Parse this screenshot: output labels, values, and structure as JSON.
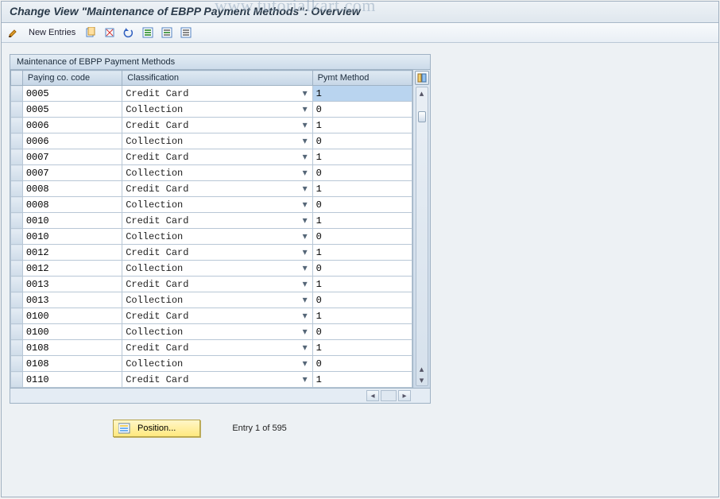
{
  "title": "Change View \"Maintenance of EBPP Payment Methods\": Overview",
  "watermark": "www.tutorialkart.com",
  "toolbar": {
    "new_entries_label": "New Entries"
  },
  "panel": {
    "title": "Maintenance of EBPP Payment Methods",
    "columns": {
      "paying_co": "Paying co. code",
      "classification": "Classification",
      "pymt_method": "Pymt Method"
    },
    "rows": [
      {
        "code": "0005",
        "classification": "Credit Card",
        "method": "1",
        "highlight": true
      },
      {
        "code": "0005",
        "classification": "Collection",
        "method": "0"
      },
      {
        "code": "0006",
        "classification": "Credit Card",
        "method": "1"
      },
      {
        "code": "0006",
        "classification": "Collection",
        "method": "0"
      },
      {
        "code": "0007",
        "classification": "Credit Card",
        "method": "1"
      },
      {
        "code": "0007",
        "classification": "Collection",
        "method": "0"
      },
      {
        "code": "0008",
        "classification": "Credit Card",
        "method": "1"
      },
      {
        "code": "0008",
        "classification": "Collection",
        "method": "0"
      },
      {
        "code": "0010",
        "classification": "Credit Card",
        "method": "1"
      },
      {
        "code": "0010",
        "classification": "Collection",
        "method": "0"
      },
      {
        "code": "0012",
        "classification": "Credit Card",
        "method": "1"
      },
      {
        "code": "0012",
        "classification": "Collection",
        "method": "0"
      },
      {
        "code": "0013",
        "classification": "Credit Card",
        "method": "1"
      },
      {
        "code": "0013",
        "classification": "Collection",
        "method": "0"
      },
      {
        "code": "0100",
        "classification": "Credit Card",
        "method": "1"
      },
      {
        "code": "0100",
        "classification": "Collection",
        "method": "0"
      },
      {
        "code": "0108",
        "classification": "Credit Card",
        "method": "1"
      },
      {
        "code": "0108",
        "classification": "Collection",
        "method": "0"
      },
      {
        "code": "0110",
        "classification": "Credit Card",
        "method": "1"
      }
    ]
  },
  "footer": {
    "position_label": "Position...",
    "entry_status": "Entry 1 of 595"
  }
}
